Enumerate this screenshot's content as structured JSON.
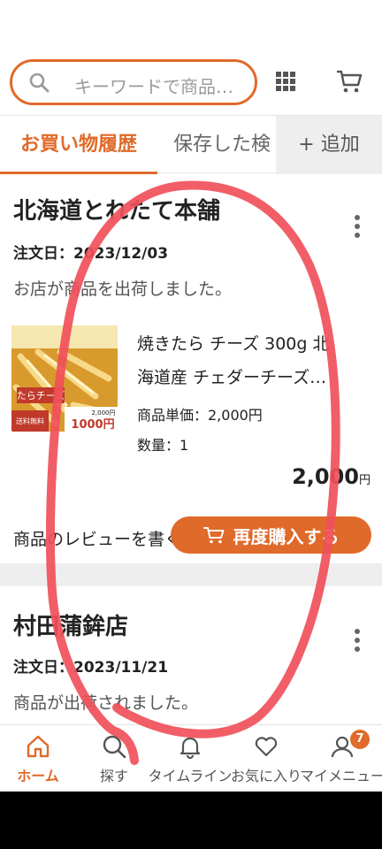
{
  "search": {
    "placeholder": "キーワードで商品…"
  },
  "header": {
    "grid_icon": "grid-icon",
    "cart_icon": "cart-icon"
  },
  "tabs": [
    {
      "label": "お買い物履歴",
      "active": true
    },
    {
      "label": "保存した検",
      "active": false
    },
    {
      "label": "+ 追加",
      "active": false
    }
  ],
  "orders": [
    {
      "shop": "北海道とれたて本舗",
      "date": "注文日：2023/12/03",
      "status": "お店が商品を出荷しました。",
      "product": {
        "name_line1": "焼きたら チーズ 300g 北",
        "name_line2": "海道産 チェダーチーズ…",
        "unit_price": "商品単価：2,000円",
        "quantity": "数量：1",
        "price": "2,000",
        "price_unit": "円",
        "thumb_texts": [
          "たらチーズ",
          "送料無料",
          "1000円",
          "2,000円"
        ]
      },
      "review_link": "商品のレビューを書く",
      "rebuy_label": "再度購入する"
    },
    {
      "shop": "村田蒲鉾店",
      "date": "注文日：2023/11/21",
      "status": "商品が出荷されました。"
    }
  ],
  "bottom_nav": [
    {
      "label": "ホーム",
      "icon": "home-icon",
      "active": true
    },
    {
      "label": "探す",
      "icon": "search-icon",
      "active": false
    },
    {
      "label": "タイムライン",
      "icon": "bell-icon",
      "active": false
    },
    {
      "label": "お気に入り",
      "icon": "heart-icon",
      "active": false
    },
    {
      "label": "マイメニュー",
      "icon": "person-icon",
      "active": false,
      "badge": "7"
    }
  ],
  "colors": {
    "accent": "#e06a2a",
    "annotation": "#f0505a"
  }
}
